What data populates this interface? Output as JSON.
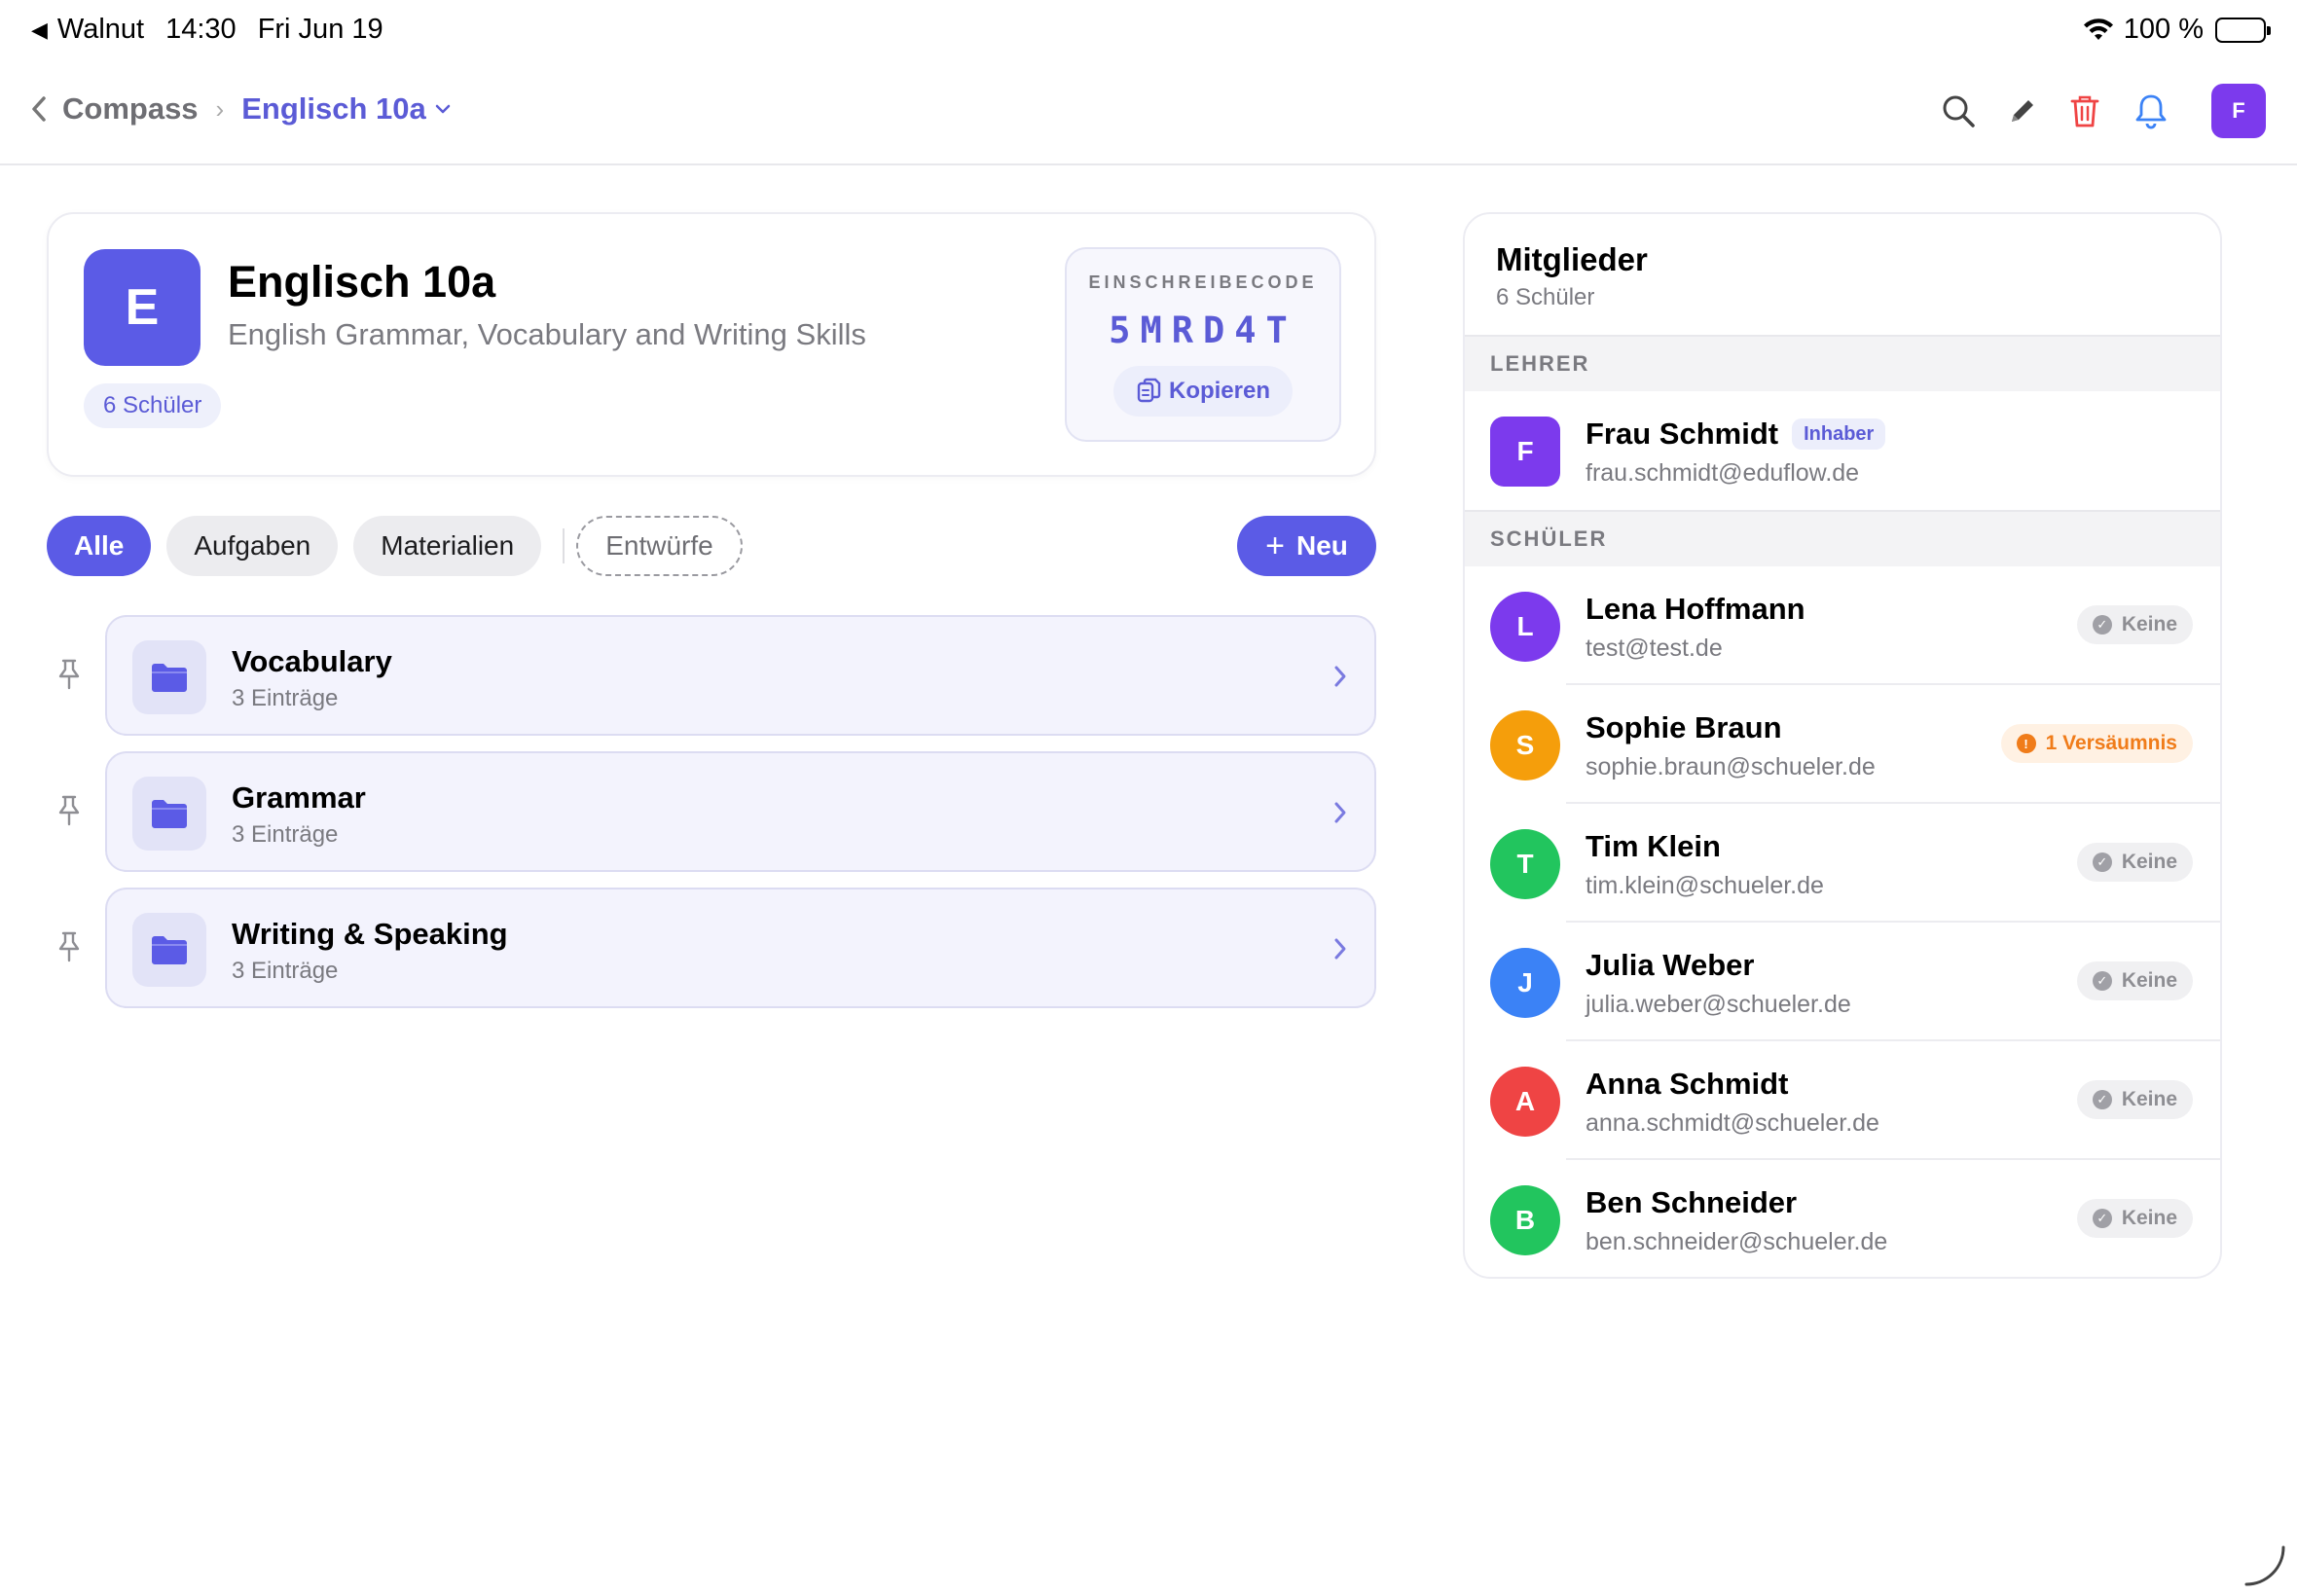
{
  "status_bar": {
    "back_app": "Walnut",
    "time": "14:30",
    "date": "Fri Jun 19",
    "battery": "100 %"
  },
  "nav": {
    "parent": "Compass",
    "current": "Englisch 10a",
    "avatar_initial": "F",
    "icons": [
      "search-icon",
      "pencil-icon",
      "trash-icon",
      "bell-icon"
    ]
  },
  "course": {
    "initial": "E",
    "title": "Englisch 10a",
    "subtitle": "English Grammar, Vocabulary and Writing Skills",
    "student_count": "6 Schüler",
    "code_label": "EINSCHREIBECODE",
    "code": "5MRD4T",
    "copy_label": "Kopieren"
  },
  "filters": {
    "chips": [
      "Alle",
      "Aufgaben",
      "Materialien"
    ],
    "drafts": "Entwürfe",
    "active": "Alle",
    "new_label": "Neu"
  },
  "folders": [
    {
      "name": "Vocabulary",
      "count": "3 Einträge"
    },
    {
      "name": "Grammar",
      "count": "3 Einträge"
    },
    {
      "name": "Writing & Speaking",
      "count": "3 Einträge"
    }
  ],
  "members": {
    "title": "Mitglieder",
    "count": "6 Schüler",
    "teacher_heading": "LEHRER",
    "teacher": {
      "initial": "F",
      "name": "Frau Schmidt",
      "badge": "Inhaber",
      "email": "frau.schmidt@eduflow.de",
      "color": "#7c3aed"
    },
    "students_heading": "SCHÜLER",
    "students": [
      {
        "initial": "L",
        "name": "Lena Hoffmann",
        "email": "test@test.de",
        "status": "Keine",
        "status_type": "none",
        "color": "#7c3aed"
      },
      {
        "initial": "S",
        "name": "Sophie Braun",
        "email": "sophie.braun@schueler.de",
        "status": "1 Versäumnis",
        "status_type": "warn",
        "color": "#f59e0b"
      },
      {
        "initial": "T",
        "name": "Tim Klein",
        "email": "tim.klein@schueler.de",
        "status": "Keine",
        "status_type": "none",
        "color": "#22c55e"
      },
      {
        "initial": "J",
        "name": "Julia Weber",
        "email": "julia.weber@schueler.de",
        "status": "Keine",
        "status_type": "none",
        "color": "#3b82f6"
      },
      {
        "initial": "A",
        "name": "Anna Schmidt",
        "email": "anna.schmidt@schueler.de",
        "status": "Keine",
        "status_type": "none",
        "color": "#ef4444"
      },
      {
        "initial": "B",
        "name": "Ben Schneider",
        "email": "ben.schneider@schueler.de",
        "status": "Keine",
        "status_type": "none",
        "color": "#22c55e"
      }
    ]
  },
  "colors": {
    "accent": "#5b5be6",
    "destructive": "#ef4444",
    "bell": "#3b82f6",
    "warning": "#f07c1a"
  }
}
